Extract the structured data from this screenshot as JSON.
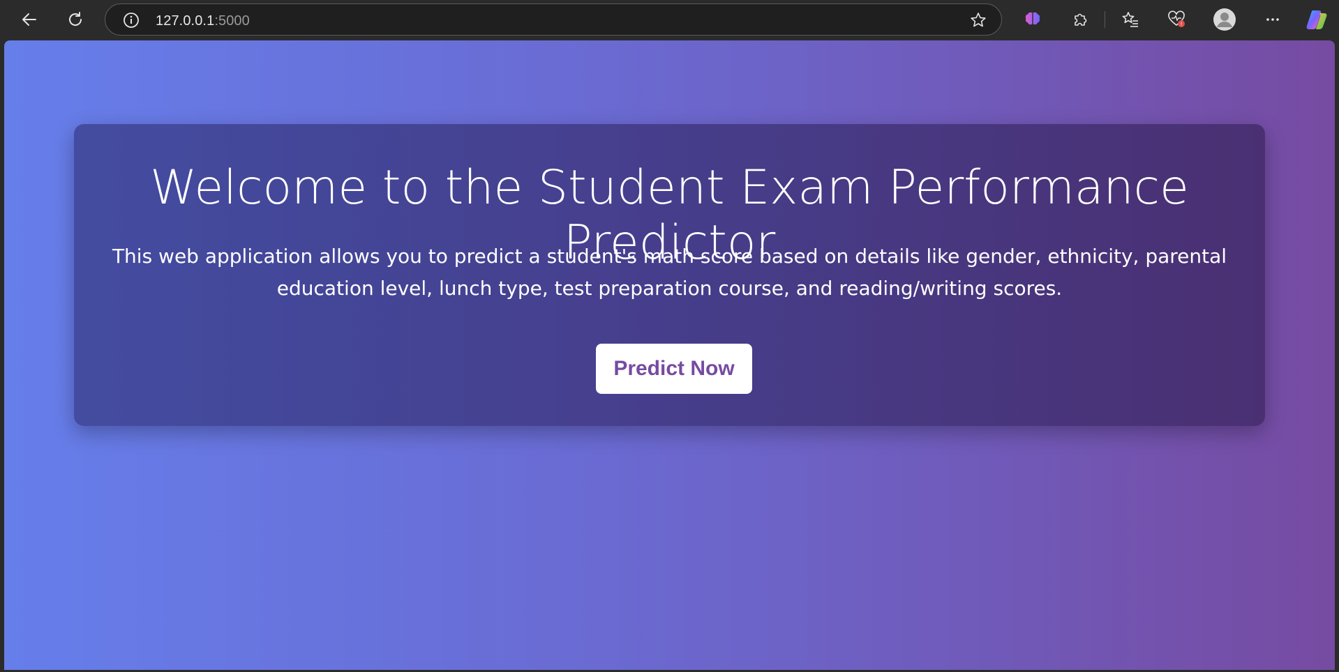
{
  "browser": {
    "url_host": "127.0.0.1",
    "url_port": ":5000",
    "icons": {
      "back": "arrow-left-icon",
      "reload": "reload-icon",
      "site_info": "info-icon",
      "favorite": "star-icon",
      "copilot_brain": "brain-icon",
      "extensions": "puzzle-icon",
      "favorites": "favorites-icon",
      "health": "heart-icon",
      "profile": "avatar-icon",
      "menu": "more-icon",
      "copilot": "copilot-icon"
    }
  },
  "page": {
    "title": "Welcome to the Student Exam Performance Predictor",
    "description": "This web application allows you to predict a student's math score based on details like gender, ethnicity, parental education level, lunch type, test preparation course, and reading/writing scores.",
    "cta_label": "Predict Now"
  },
  "colors": {
    "gradient_start": "#667eea",
    "gradient_end": "#764ba2",
    "button_text": "#764ba2"
  }
}
